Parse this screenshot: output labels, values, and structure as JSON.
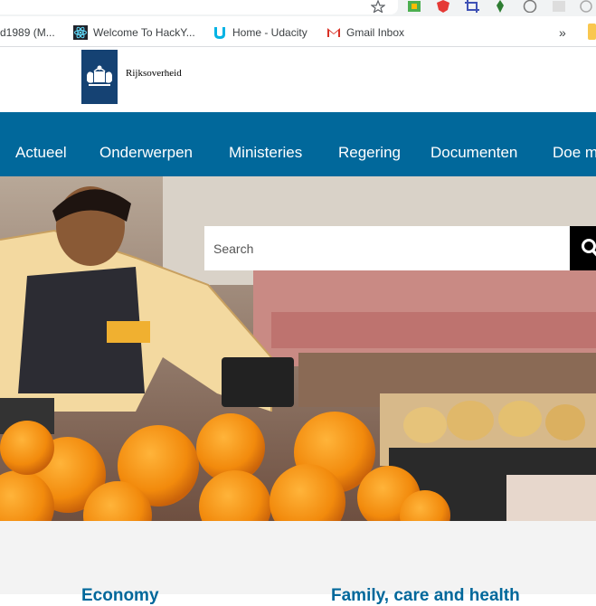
{
  "browser": {
    "bookmarks": [
      {
        "label": "d1989 (M...",
        "icon": "bookmark-favicon"
      },
      {
        "label": "Welcome To HackY...",
        "icon": "react-atom-icon"
      },
      {
        "label": "Home - Udacity",
        "icon": "udacity-icon"
      },
      {
        "label": "Gmail Inbox",
        "icon": "gmail-icon"
      }
    ],
    "more_label": "»"
  },
  "site": {
    "logo_text": "Rijksoverheid",
    "brand_color": "#154273",
    "nav_color": "#01689b"
  },
  "nav": {
    "items": [
      "Actueel",
      "Onderwerpen",
      "Ministeries",
      "Regering",
      "Documenten",
      "Doe m"
    ]
  },
  "search": {
    "placeholder": "Search"
  },
  "sections": {
    "left_title": "Economy",
    "right_title": "Family, care and health"
  }
}
